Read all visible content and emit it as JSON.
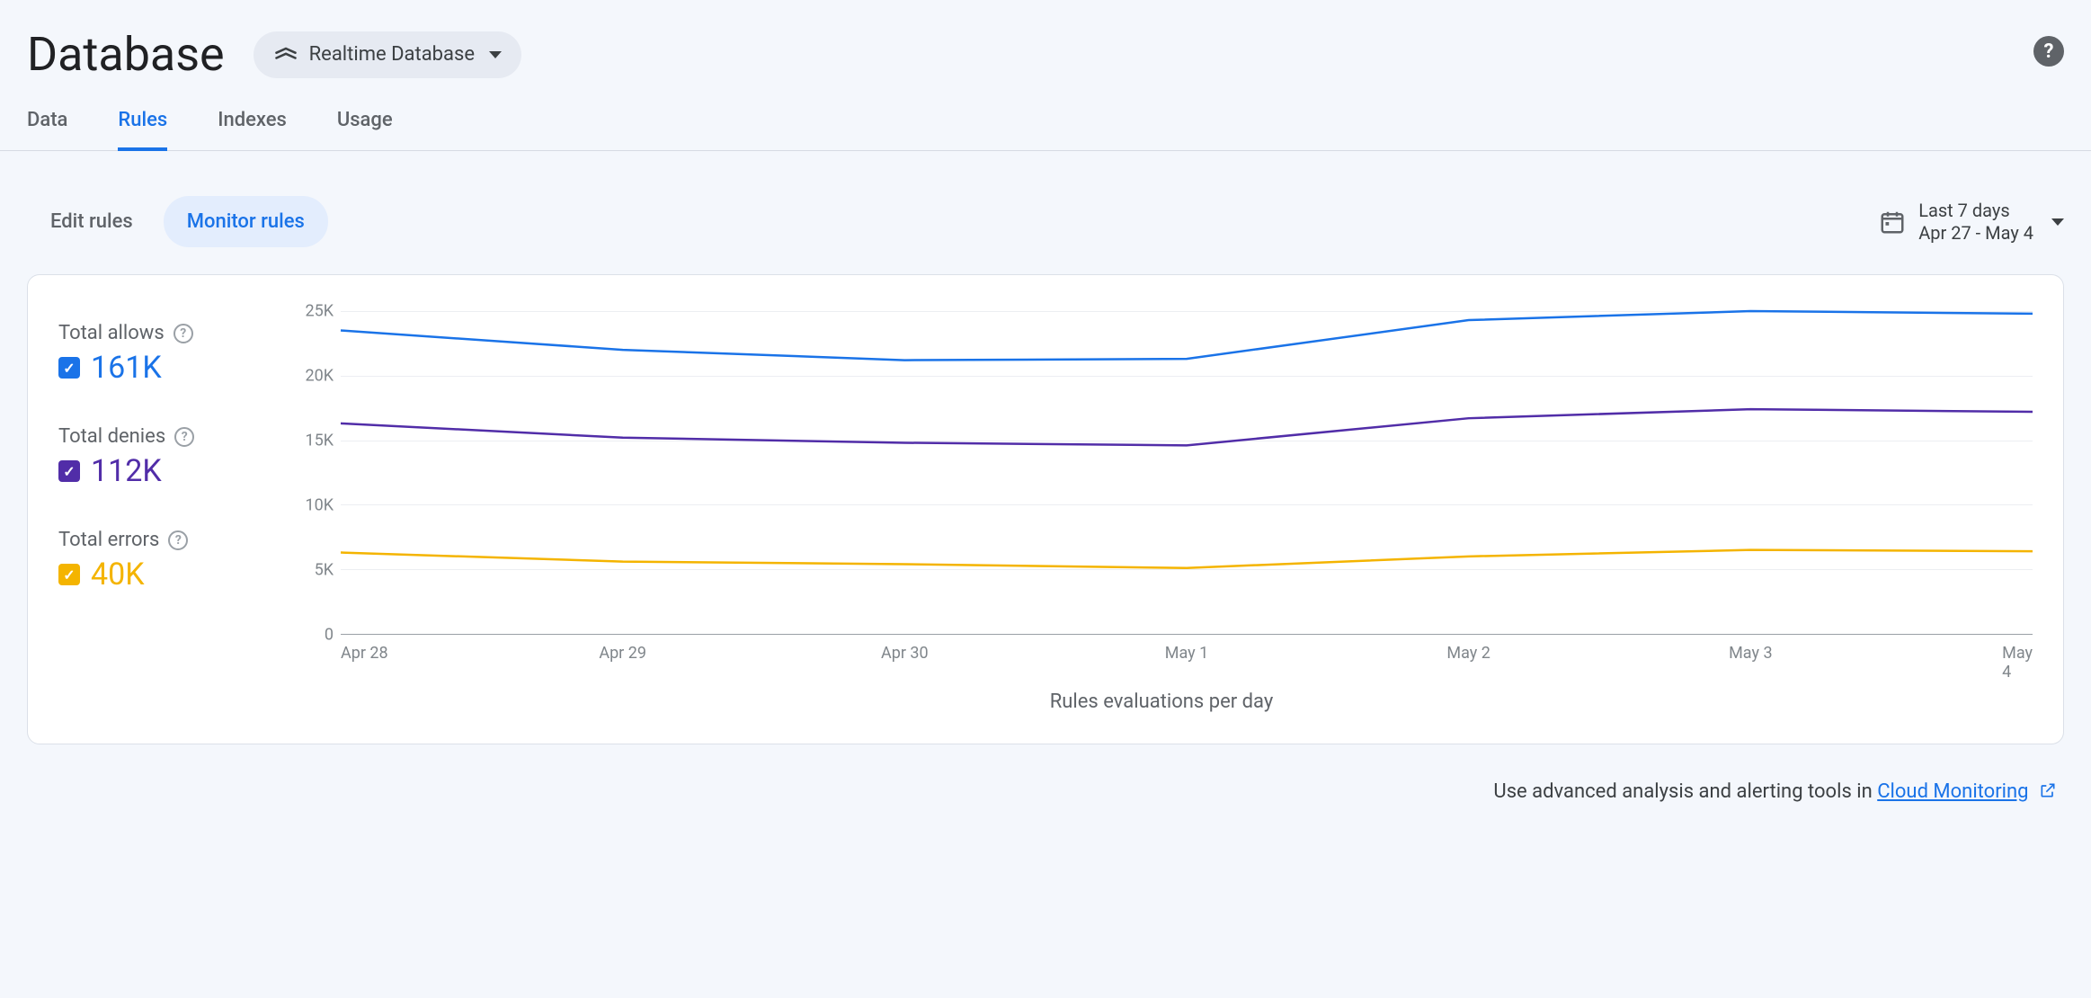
{
  "header": {
    "title": "Database",
    "db_selector_label": "Realtime Database",
    "help_glyph": "?"
  },
  "tabs": [
    {
      "id": "data",
      "label": "Data",
      "active": false
    },
    {
      "id": "rules",
      "label": "Rules",
      "active": true
    },
    {
      "id": "indexes",
      "label": "Indexes",
      "active": false
    },
    {
      "id": "usage",
      "label": "Usage",
      "active": false
    }
  ],
  "subtabs": [
    {
      "id": "edit",
      "label": "Edit rules",
      "active": false
    },
    {
      "id": "monitor",
      "label": "Monitor rules",
      "active": true
    }
  ],
  "date_picker": {
    "line1": "Last 7 days",
    "line2": "Apr 27 - May 4"
  },
  "legend": {
    "allows": {
      "label": "Total allows",
      "value": "161K",
      "color": "#1a73e8"
    },
    "denies": {
      "label": "Total denies",
      "value": "112K",
      "color": "#512da8"
    },
    "errors": {
      "label": "Total errors",
      "value": "40K",
      "color": "#f4b400"
    }
  },
  "chart_data": {
    "type": "line",
    "xlabel": "Rules evaluations per day",
    "ylabel": "",
    "ylim": [
      0,
      25000
    ],
    "y_ticks": [
      "0",
      "5K",
      "10K",
      "15K",
      "20K",
      "25K"
    ],
    "categories": [
      "Apr 28",
      "Apr 29",
      "Apr 30",
      "May 1",
      "May 2",
      "May 3",
      "May 4"
    ],
    "series": [
      {
        "name": "Total allows",
        "color": "#1a73e8",
        "values": [
          23500,
          22000,
          21200,
          21300,
          24300,
          25000,
          24800
        ]
      },
      {
        "name": "Total denies",
        "color": "#512da8",
        "values": [
          16300,
          15200,
          14800,
          14600,
          16700,
          17400,
          17200
        ]
      },
      {
        "name": "Total errors",
        "color": "#f4b400",
        "values": [
          6300,
          5600,
          5400,
          5100,
          6000,
          6500,
          6400
        ]
      }
    ]
  },
  "footer": {
    "prefix": "Use advanced analysis and alerting tools in ",
    "link_text": "Cloud Monitoring"
  },
  "colors": {
    "primary": "#1a73e8",
    "purple": "#512da8",
    "amber": "#f4b400"
  }
}
